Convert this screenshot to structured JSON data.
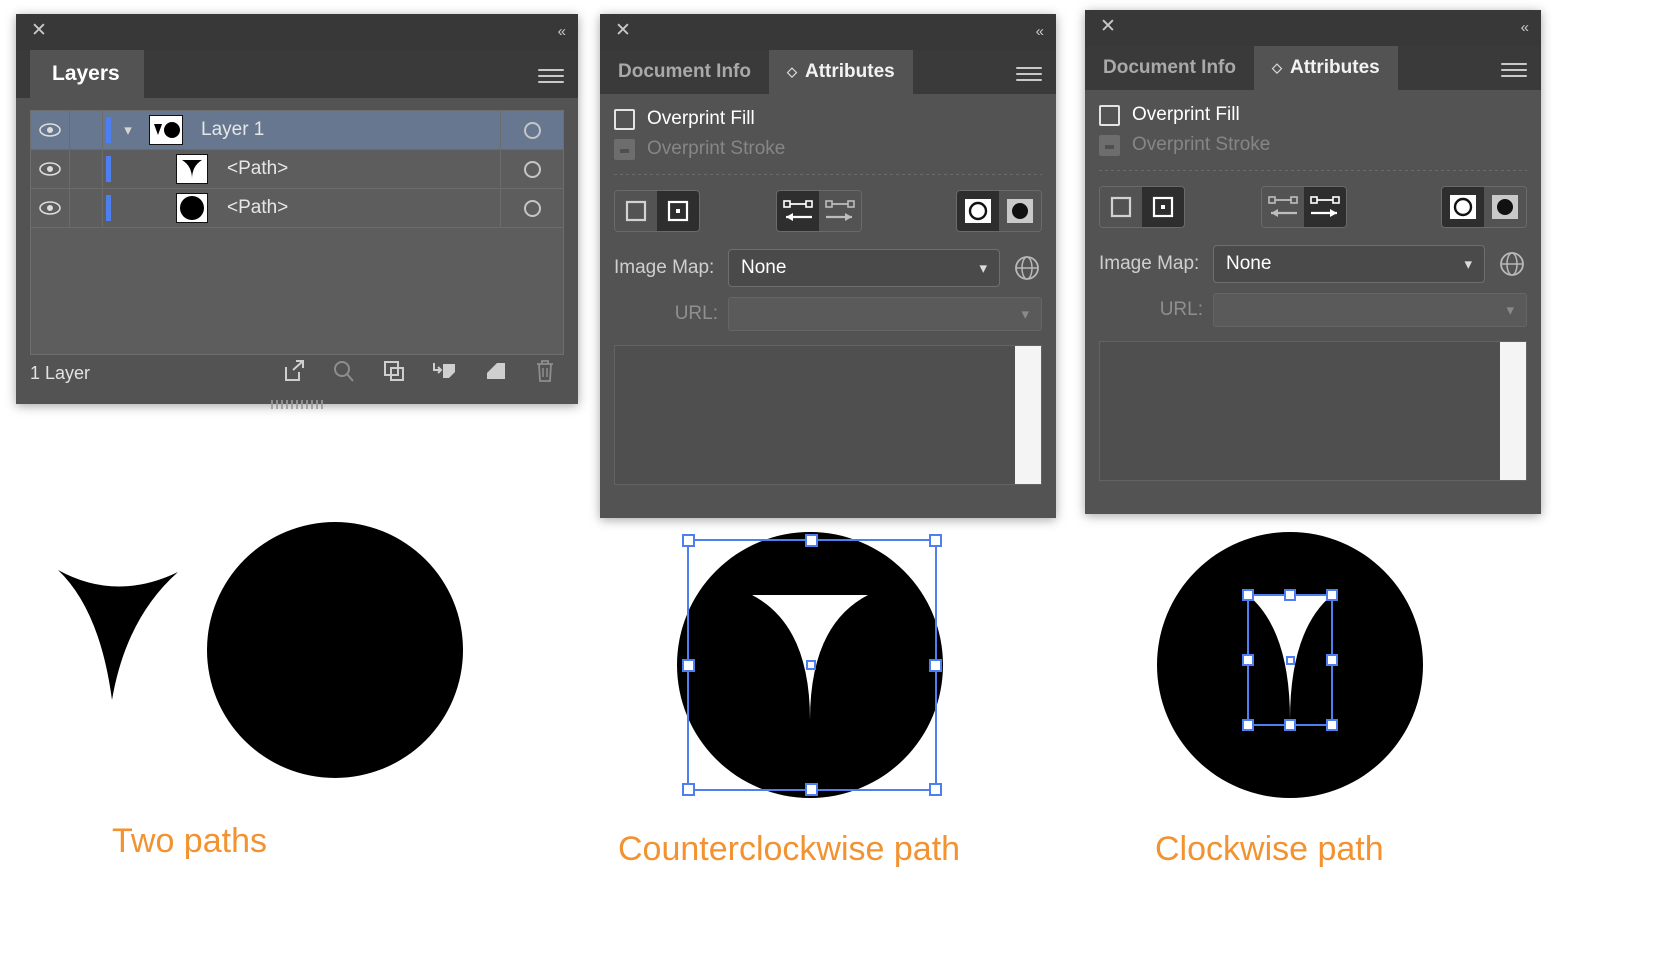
{
  "layers_panel": {
    "tab_label": "Layers",
    "close_icon": "close-icon",
    "collapse_icon": "double-chevron-left-icon",
    "menu_icon": "panel-menu-icon",
    "rows": [
      {
        "name": "Layer 1",
        "thumb": "layer-thumb-two-shapes",
        "expand": "chevron-down-icon",
        "selected": true
      },
      {
        "name": "<Path>",
        "thumb": "path-thumb-triangle",
        "expand": "",
        "selected": false
      },
      {
        "name": "<Path>",
        "thumb": "path-thumb-circle",
        "expand": "",
        "selected": false
      }
    ],
    "footer": {
      "count_label": "1 Layer",
      "icons": [
        "locate-object-icon",
        "search-icon",
        "duplicate-layer-icon",
        "release-to-layers-icon",
        "new-sublayer-icon",
        "delete-layer-icon"
      ]
    }
  },
  "attributes_mid": {
    "close_icon": "close-icon",
    "collapse_icon": "double-chevron-left-icon",
    "menu_icon": "panel-menu-icon",
    "tabs": [
      {
        "label": "Document Info",
        "active": false
      },
      {
        "label": "Attributes",
        "active": true,
        "diamond": "◇"
      }
    ],
    "overprint_fill": {
      "label": "Overprint Fill",
      "checked": false,
      "disabled": false
    },
    "overprint_stroke": {
      "label": "Overprint Stroke",
      "checked": false,
      "disabled": true
    },
    "center_buttons": [
      {
        "icon": "hide-center-icon",
        "active": false
      },
      {
        "icon": "show-center-icon",
        "active": true
      }
    ],
    "direction_buttons": [
      {
        "icon": "reverse-path-direction-icon",
        "active": true
      },
      {
        "icon": "forward-path-direction-icon",
        "active": false
      }
    ],
    "compound_buttons": [
      {
        "icon": "nonzero-fill-icon",
        "active": true
      },
      {
        "icon": "evenodd-fill-icon",
        "active": false
      }
    ],
    "image_map": {
      "label": "Image Map:",
      "value": "None",
      "chevron": "∨"
    },
    "browser_icon": "globe-icon",
    "url": {
      "label": "URL:",
      "value": "",
      "chevron": "∨",
      "disabled": true
    }
  },
  "attributes_right": {
    "close_icon": "close-icon",
    "collapse_icon": "double-chevron-left-icon",
    "menu_icon": "panel-menu-icon",
    "tabs": [
      {
        "label": "Document Info",
        "active": false
      },
      {
        "label": "Attributes",
        "active": true,
        "diamond": "◇"
      }
    ],
    "overprint_fill": {
      "label": "Overprint Fill",
      "checked": false,
      "disabled": false
    },
    "overprint_stroke": {
      "label": "Overprint Stroke",
      "checked": false,
      "disabled": true
    },
    "center_buttons": [
      {
        "icon": "hide-center-icon",
        "active": false
      },
      {
        "icon": "show-center-icon",
        "active": true
      }
    ],
    "direction_buttons": [
      {
        "icon": "reverse-path-direction-icon",
        "active": false
      },
      {
        "icon": "forward-path-direction-icon",
        "active": true
      }
    ],
    "compound_buttons": [
      {
        "icon": "nonzero-fill-icon",
        "active": true
      },
      {
        "icon": "evenodd-fill-icon",
        "active": false
      }
    ],
    "image_map": {
      "label": "Image Map:",
      "value": "None",
      "chevron": "∨"
    },
    "browser_icon": "globe-icon",
    "url": {
      "label": "URL:",
      "value": "",
      "chevron": "∨",
      "disabled": true
    }
  },
  "artwork": {
    "captions": [
      {
        "text": "Two paths"
      },
      {
        "text": "Counterclockwise path"
      },
      {
        "text": "Clockwise path"
      }
    ],
    "colors": {
      "caption": "#f29230",
      "shape": "#000000",
      "selection": "#4d7ff0",
      "panel_bg": "#535353",
      "panel_header": "#383838",
      "row_selected": "#66778f"
    }
  }
}
